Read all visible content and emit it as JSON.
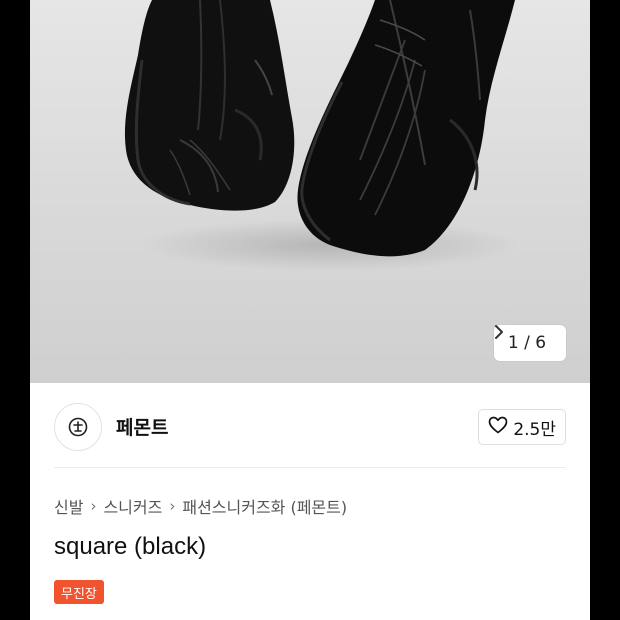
{
  "gallery": {
    "counter": "1 / 6",
    "next_icon": "chevron-right-icon"
  },
  "brand": {
    "name": "페몬트",
    "logo_icon": "brand-logo-icon"
  },
  "like": {
    "count": "2.5만",
    "icon": "heart-icon"
  },
  "breadcrumb": [
    "신발",
    "스니커즈",
    "패션스니커즈화 (페몬트)"
  ],
  "product": {
    "title": "square (black)",
    "badge": "무진장"
  },
  "colors": {
    "badge": "#f0532e",
    "photo_bg": "#dcdcdc",
    "page_bg": "#ffffff"
  }
}
